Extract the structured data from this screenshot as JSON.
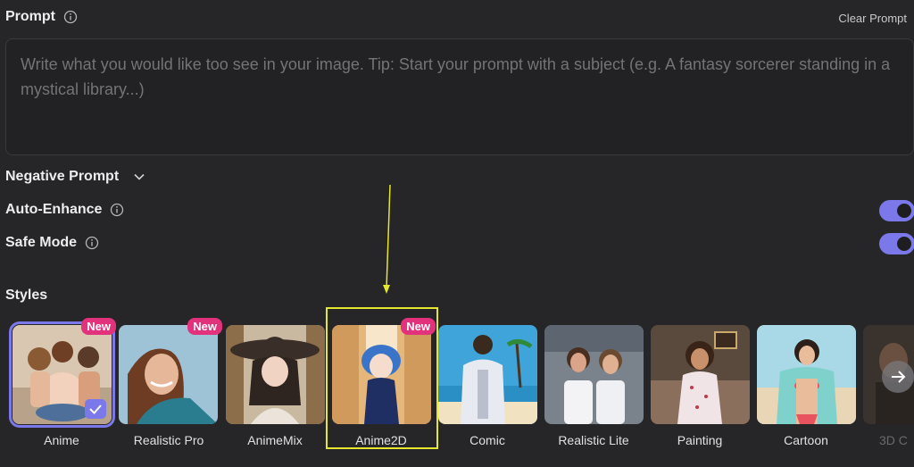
{
  "prompt": {
    "label": "Prompt",
    "clear_label": "Clear Prompt",
    "placeholder": "Write what you would like too see in your image. Tip: Start your prompt with a subject (e.g. A fantasy sorcerer standing in a mystical library...)",
    "value": ""
  },
  "negative_prompt": {
    "label": "Negative Prompt"
  },
  "auto_enhance": {
    "label": "Auto-Enhance",
    "enabled": true
  },
  "safe_mode": {
    "label": "Safe Mode",
    "enabled": true
  },
  "styles": {
    "title": "Styles",
    "items": [
      {
        "name": "Anime",
        "badge": "New",
        "selected": true
      },
      {
        "name": "Realistic Pro",
        "badge": "New",
        "selected": false
      },
      {
        "name": "AnimeMix",
        "badge": "",
        "selected": false
      },
      {
        "name": "Anime2D",
        "badge": "New",
        "selected": false
      },
      {
        "name": "Comic",
        "badge": "",
        "selected": false
      },
      {
        "name": "Realistic Lite",
        "badge": "",
        "selected": false
      },
      {
        "name": "Painting",
        "badge": "",
        "selected": false
      },
      {
        "name": "Cartoon",
        "badge": "",
        "selected": false
      },
      {
        "name": "3D C",
        "badge": "",
        "selected": false
      }
    ]
  },
  "colors": {
    "background": "#262628",
    "accent": "#7b79ea",
    "badge": "#e2327c",
    "annotation": "#e6e62e"
  }
}
